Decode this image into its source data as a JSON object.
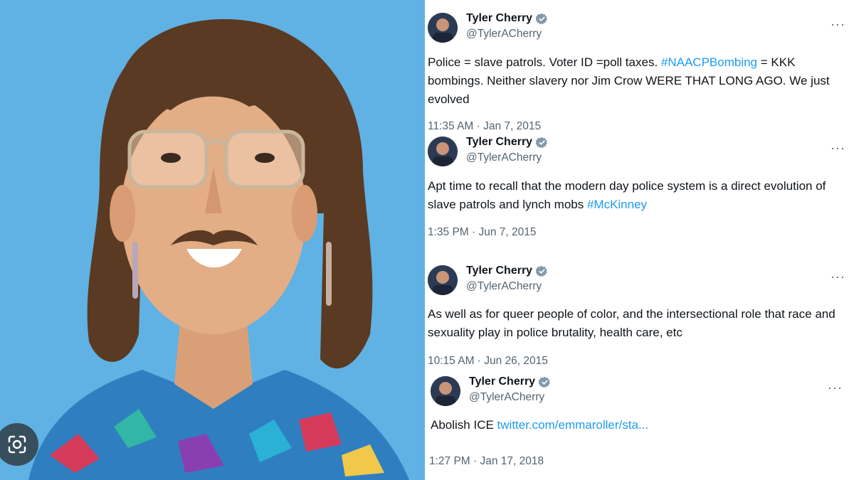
{
  "tweets": [
    {
      "name": "Tyler Cherry",
      "handle": "@TylerACherry",
      "more": "···",
      "text_parts": [
        "Police = slave patrols. Voter ID =poll taxes. ",
        "#NAACPBombing",
        " = KKK bombings. Neither slavery nor Jim Crow WERE THAT LONG AGO. We just evolved"
      ],
      "timestamp": "11:35 AM · Jan 7, 2015"
    },
    {
      "name": "Tyler Cherry",
      "handle": "@TylerACherry",
      "more": "···",
      "text_parts": [
        "Apt time to recall that the modern day police system is a direct evolution of slave patrols and lynch mobs ",
        "#McKinney"
      ],
      "timestamp": "1:35 PM · Jun 7, 2015"
    },
    {
      "name": "Tyler Cherry",
      "handle": "@TylerACherry",
      "more": "···",
      "text_parts": [
        "As well as for queer people of color, and the intersectional role that race and sexuality play in police brutality, health care, etc"
      ],
      "timestamp": "10:15 AM · Jun 26, 2015"
    },
    {
      "name": "Tyler Cherry",
      "handle": "@TylerACherry",
      "more": "···",
      "text_parts": [
        "Abolish ICE ",
        "twitter.com/emmaroller/sta..."
      ],
      "timestamp": "1:27 PM · Jan 17, 2018"
    }
  ],
  "icons": {
    "verified": "verified-badge-icon",
    "lens": "google-lens-icon",
    "more": "more-options-icon"
  },
  "colors": {
    "photo_background": "#5fb2e3",
    "link": "#1d9bf0",
    "verified": "#829aab",
    "secondary_text": "#536471"
  }
}
